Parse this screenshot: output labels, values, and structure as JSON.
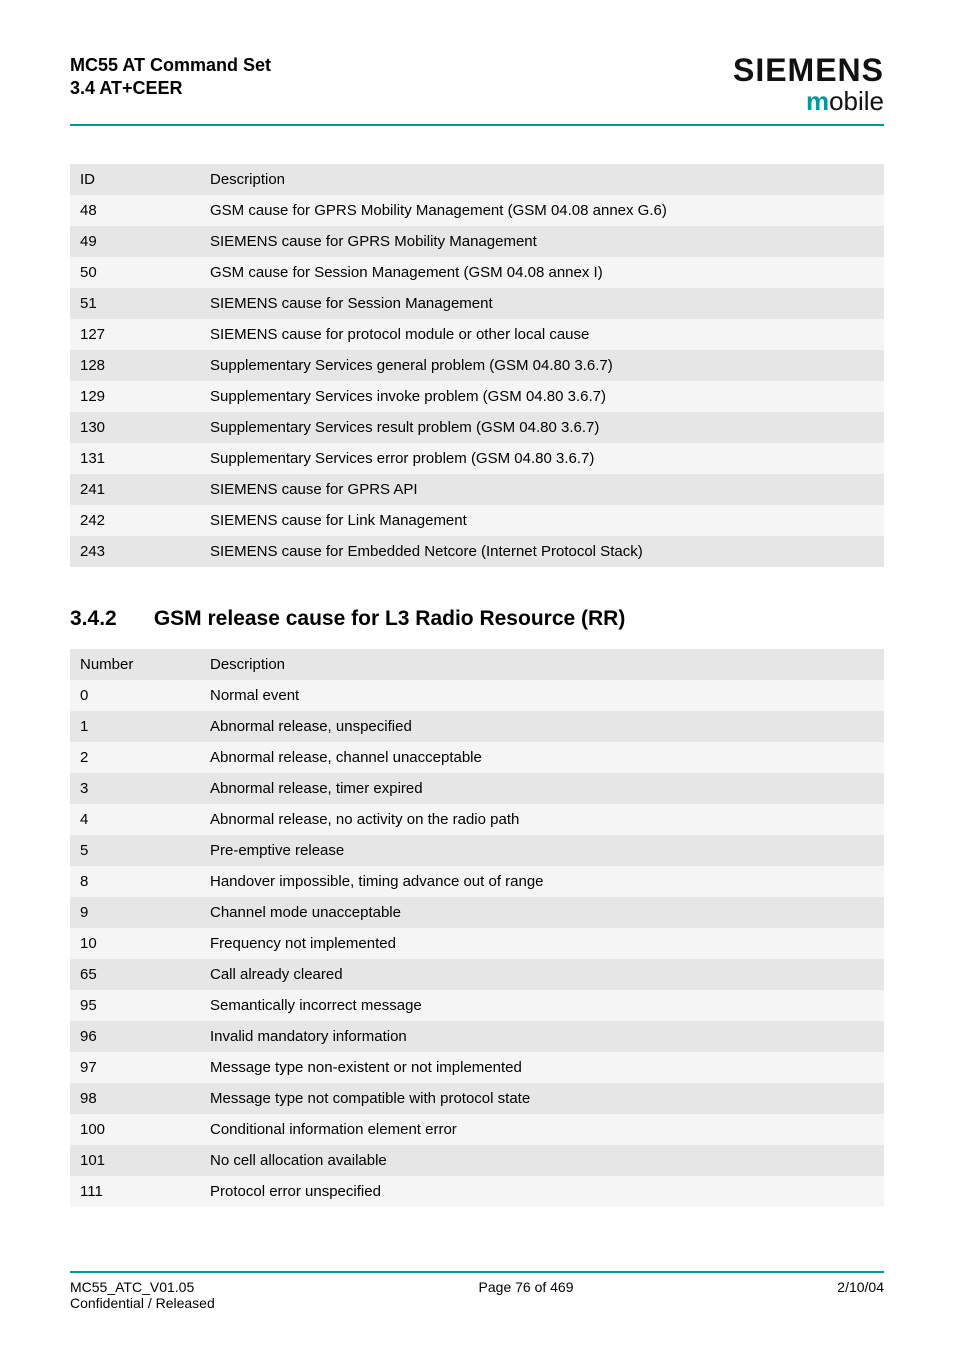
{
  "header": {
    "title_line1": "MC55 AT Command Set",
    "title_line2": "3.4 AT+CEER",
    "brand": "SIEMENS",
    "sub_m": "m",
    "sub_rest": "obile"
  },
  "table1": {
    "head_col1": "ID",
    "head_col2": "Description",
    "rows": [
      {
        "id": "48",
        "desc": "GSM cause for GPRS Mobility Management (GSM 04.08 annex G.6)"
      },
      {
        "id": "49",
        "desc": "SIEMENS cause for GPRS Mobility Management"
      },
      {
        "id": "50",
        "desc": "GSM cause for Session Management (GSM 04.08 annex I)"
      },
      {
        "id": "51",
        "desc": "SIEMENS cause for Session Management"
      },
      {
        "id": "127",
        "desc": "SIEMENS cause for protocol module or other local cause"
      },
      {
        "id": "128",
        "desc": "Supplementary Services general problem (GSM 04.80 3.6.7)"
      },
      {
        "id": "129",
        "desc": "Supplementary Services invoke problem (GSM 04.80 3.6.7)"
      },
      {
        "id": "130",
        "desc": "Supplementary Services result problem (GSM 04.80 3.6.7)"
      },
      {
        "id": "131",
        "desc": "Supplementary Services error problem (GSM 04.80 3.6.7)"
      },
      {
        "id": "241",
        "desc": "SIEMENS cause for GPRS API"
      },
      {
        "id": "242",
        "desc": "SIEMENS cause for Link Management"
      },
      {
        "id": "243",
        "desc": "SIEMENS cause for Embedded Netcore (Internet Protocol Stack)"
      }
    ]
  },
  "section": {
    "number": "3.4.2",
    "title": "GSM release cause for L3 Radio Resource (RR)"
  },
  "table2": {
    "head_col1": "Number",
    "head_col2": "Description",
    "rows": [
      {
        "id": "0",
        "desc": "Normal event"
      },
      {
        "id": "1",
        "desc": "Abnormal release, unspecified"
      },
      {
        "id": "2",
        "desc": "Abnormal release, channel unacceptable"
      },
      {
        "id": "3",
        "desc": "Abnormal release, timer expired"
      },
      {
        "id": "4",
        "desc": "Abnormal release, no activity on the radio path"
      },
      {
        "id": "5",
        "desc": "Pre-emptive release"
      },
      {
        "id": "8",
        "desc": "Handover impossible, timing advance out of range"
      },
      {
        "id": "9",
        "desc": "Channel mode unacceptable"
      },
      {
        "id": "10",
        "desc": "Frequency not implemented"
      },
      {
        "id": "65",
        "desc": "Call already cleared"
      },
      {
        "id": "95",
        "desc": "Semantically incorrect message"
      },
      {
        "id": "96",
        "desc": "Invalid mandatory information"
      },
      {
        "id": "97",
        "desc": "Message type non-existent or not implemented"
      },
      {
        "id": "98",
        "desc": "Message type not compatible with protocol state"
      },
      {
        "id": "100",
        "desc": "Conditional information element error"
      },
      {
        "id": "101",
        "desc": "No cell allocation available"
      },
      {
        "id": "111",
        "desc": "Protocol error unspecified"
      }
    ]
  },
  "footer": {
    "left_line1": "MC55_ATC_V01.05",
    "left_line2": "Confidential / Released",
    "center": "Page 76 of 469",
    "right": "2/10/04"
  }
}
